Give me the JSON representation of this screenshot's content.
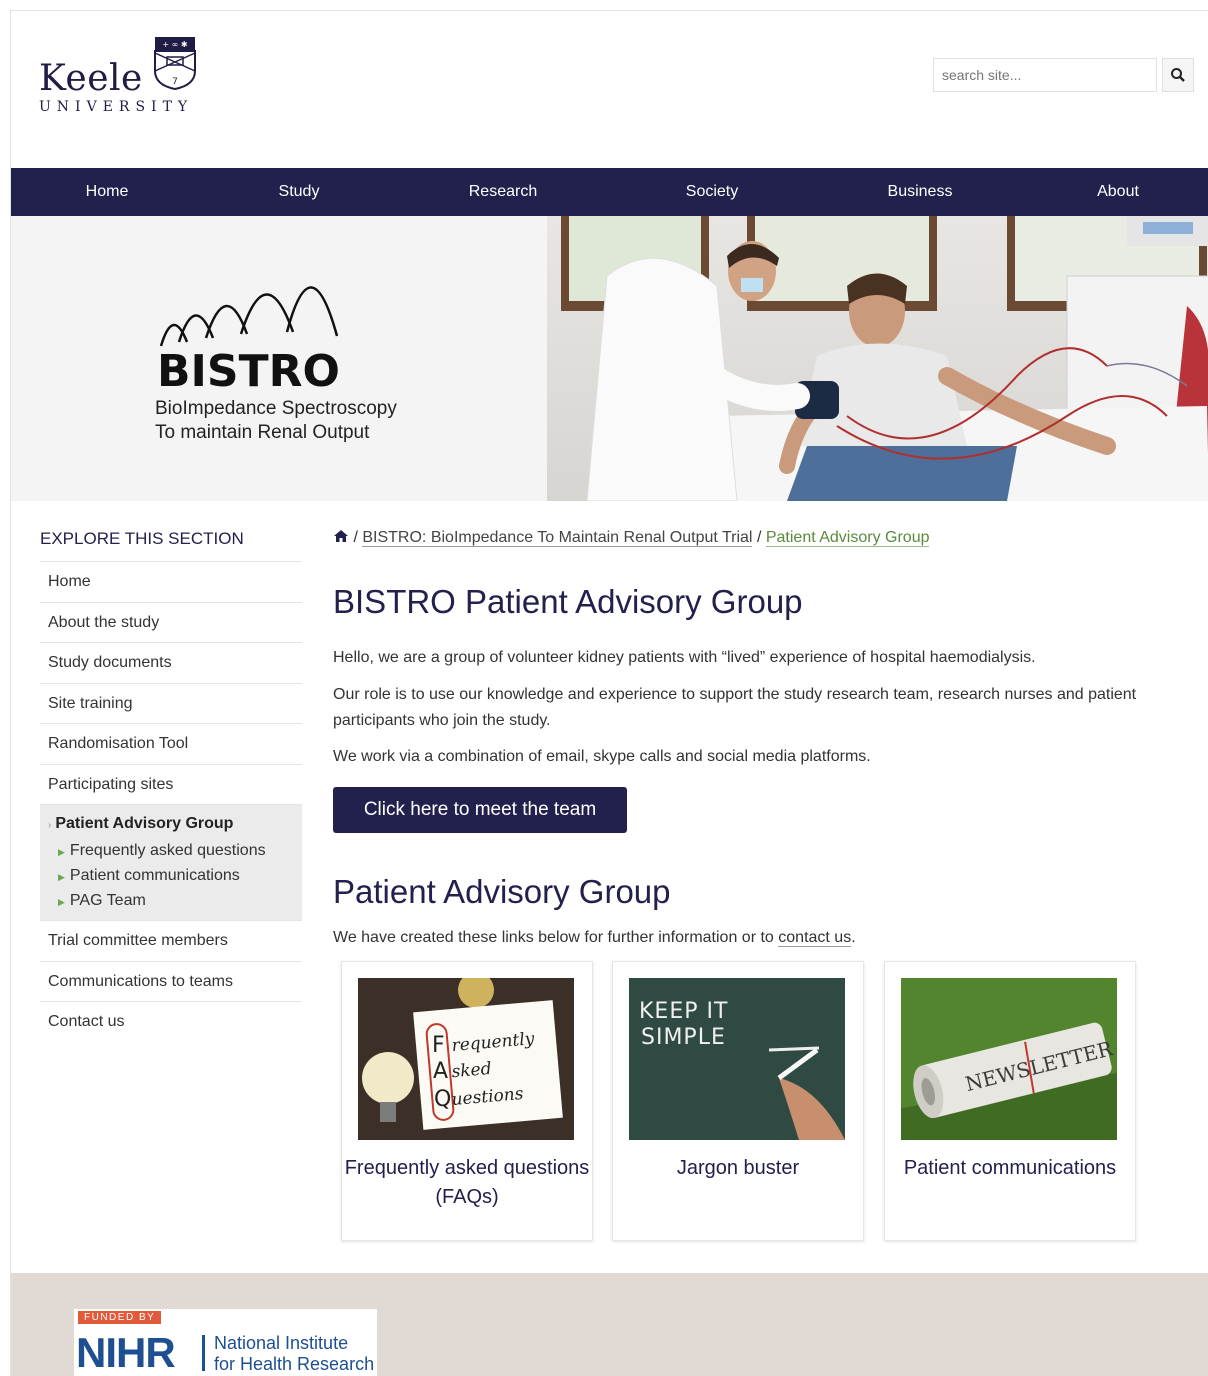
{
  "header": {
    "logo_word": "Keele",
    "logo_sub": "UNIVERSITY",
    "search_placeholder": "search site..."
  },
  "nav": [
    "Home",
    "Study",
    "Research",
    "Society",
    "Business",
    "About"
  ],
  "hero": {
    "logo_text": "BISTRO",
    "subtitle_line1": "BioImpedance Spectroscopy",
    "subtitle_line2": "To maintain Renal Output"
  },
  "sidebar": {
    "title": "EXPLORE THIS SECTION",
    "items": [
      "Home",
      "About the study",
      "Study documents",
      "Site training",
      "Randomisation Tool",
      "Participating sites"
    ],
    "active": {
      "label": "Patient Advisory Group",
      "children": [
        "Frequently asked questions",
        "Patient communications",
        "PAG Team"
      ]
    },
    "items_after": [
      "Trial committee members",
      "Communications to teams",
      "Contact us"
    ]
  },
  "breadcrumb": {
    "sep": "/",
    "parent": "BISTRO: BioImpedance To Maintain Renal Output Trial",
    "current": "Patient Advisory Group"
  },
  "main": {
    "title": "BISTRO Patient Advisory Group",
    "para1": "Hello, we are a group of volunteer kidney patients with “lived” experience of hospital haemodialysis.",
    "para2": "Our role is to use our knowledge and experience to support the study research team, research nurses and patient participants who join the study.",
    "para3": "We work via a combination of email, skype calls and social media platforms.",
    "cta": "Click here to meet the team",
    "section_title": "Patient Advisory Group",
    "intro_prefix": "We have created these links below for further information or to ",
    "intro_link": "contact us",
    "intro_suffix": ".",
    "cards": [
      {
        "label": "Frequently asked questions (FAQs)",
        "img_text": [
          "F",
          "requently",
          "A",
          "sked",
          "Q",
          "uestions"
        ]
      },
      {
        "label": "Jargon buster",
        "img_text": [
          "KEEP IT",
          "SIMPLE"
        ]
      },
      {
        "label": "Patient communications",
        "img_text": [
          "NEWSLETTER"
        ]
      }
    ]
  },
  "footer": {
    "funded_by": "FUNDED BY",
    "nihr": "NIHR",
    "nihr_line1": "National Institute",
    "nihr_line2": "for Health Research"
  },
  "colors": {
    "brand_navy": "#22214d",
    "link_green": "#5a8a3b",
    "footer_bg": "#e1dad4",
    "nihr_blue": "#1d4f91"
  }
}
